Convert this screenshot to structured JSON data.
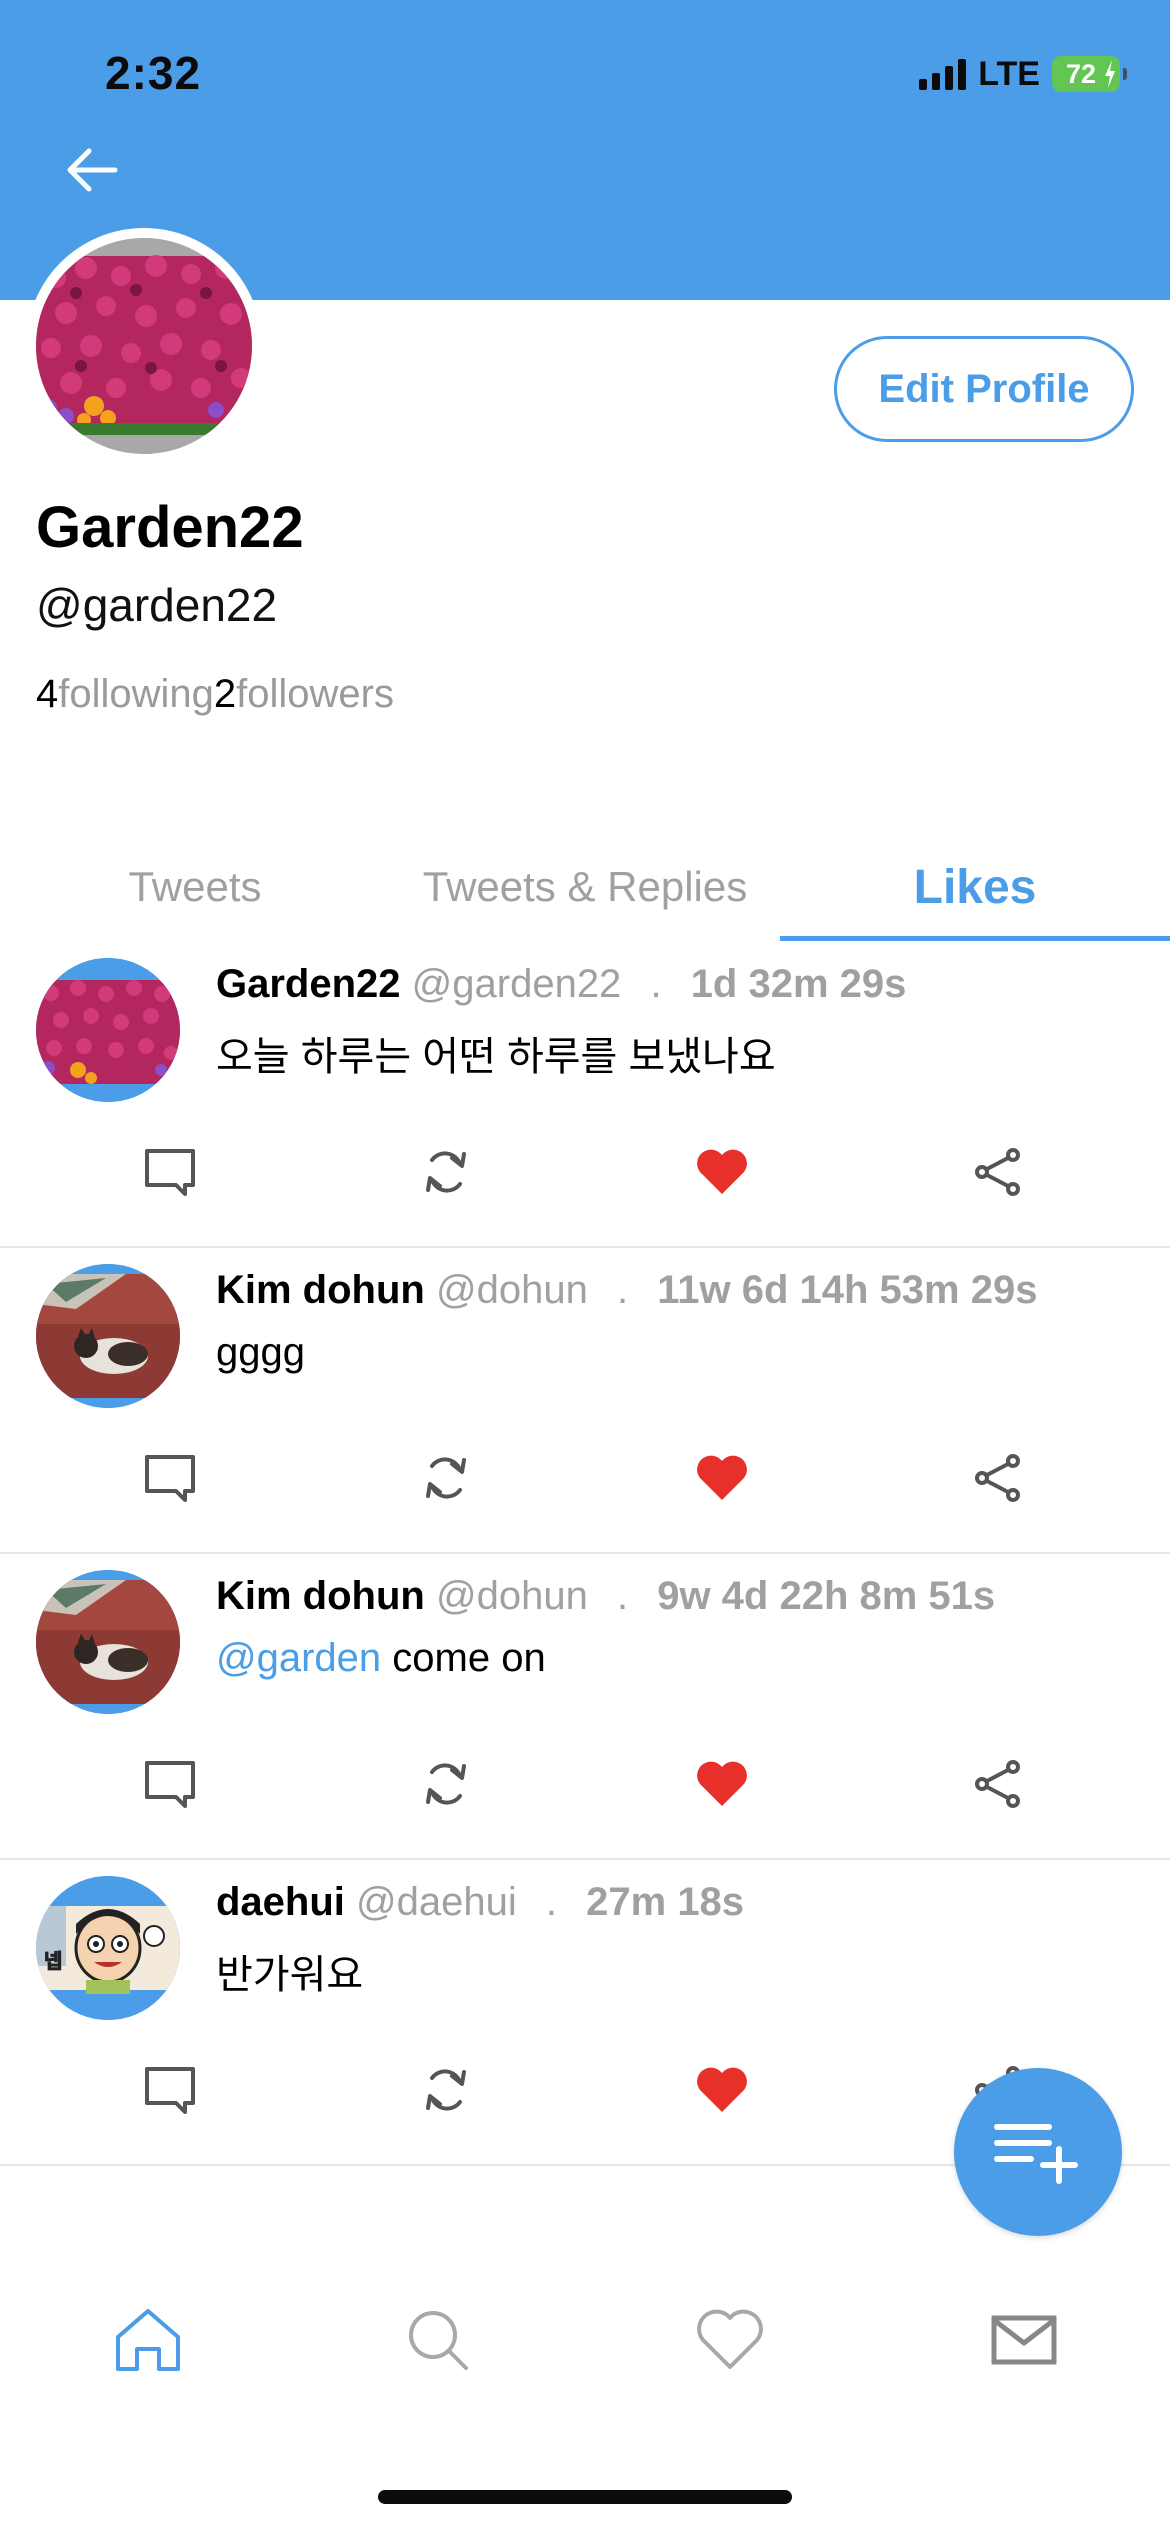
{
  "status_bar": {
    "time": "2:32",
    "network": "LTE",
    "battery": "72"
  },
  "profile": {
    "display_name": "Garden22",
    "handle": "@garden22",
    "following_count": "4",
    "following_label": "following",
    "followers_count": "2",
    "followers_label": "followers",
    "edit_button": "Edit Profile"
  },
  "tabs": [
    {
      "label": "Tweets",
      "active": false
    },
    {
      "label": "Tweets & Replies",
      "active": false
    },
    {
      "label": "Likes",
      "active": true
    }
  ],
  "tweets": [
    {
      "name": "Garden22",
      "handle": "@garden22",
      "sep": ".",
      "ago": "1d 32m 29s",
      "mention": "",
      "text": "오늘 하루는 어떤 하루를 보냈나요",
      "liked": true,
      "avatar": "flowers"
    },
    {
      "name": "Kim dohun",
      "handle": "@dohun",
      "sep": ".",
      "ago": "11w 6d 14h 53m 29s",
      "mention": "",
      "text": "gggg",
      "liked": true,
      "avatar": "cat"
    },
    {
      "name": "Kim dohun",
      "handle": "@dohun",
      "sep": ".",
      "ago": "9w 4d 22h 8m 51s",
      "mention": "@garden",
      "text": " come on",
      "liked": true,
      "avatar": "cat"
    },
    {
      "name": "daehui",
      "handle": "@daehui",
      "sep": ".",
      "ago": "27m 18s",
      "mention": "",
      "text": "반가워요",
      "liked": true,
      "avatar": "cartoon"
    }
  ],
  "avatar_cartoon_text": "넵",
  "icons": {
    "back": "arrow-left-icon",
    "comment": "comment-icon",
    "retweet": "retweet-icon",
    "like": "heart-filled-icon",
    "share": "share-icon",
    "fab": "compose-list-add-icon",
    "nav": [
      "home-icon",
      "search-icon",
      "heart-icon",
      "mail-icon"
    ]
  },
  "colors": {
    "accent": "#4a9de6",
    "like": "#e8302a",
    "muted": "#a0a0a0"
  }
}
